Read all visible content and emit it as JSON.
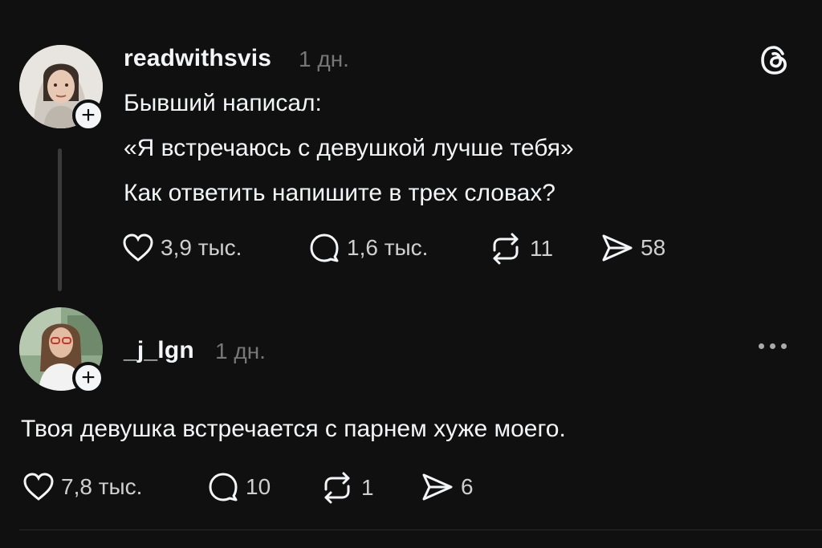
{
  "post": {
    "username": "readwithsvis",
    "time": "1 дн.",
    "lines": [
      "Бывший написал:",
      "«Я встречаюсь с девушкой лучше тебя»",
      "Как ответить напишите в трех словах?"
    ],
    "likes": "3,9 тыс.",
    "comments": "1,6 тыс.",
    "reposts": "11",
    "shares": "58"
  },
  "reply": {
    "username": "_j_lgn",
    "time": "1 дн.",
    "text": "Твоя девушка встречается с парнем хуже моего.",
    "likes": "7,8 тыс.",
    "comments": "10",
    "reposts": "1",
    "shares": "6"
  },
  "icons": {
    "follow": "plus-icon",
    "like": "heart-icon",
    "comment": "comment-icon",
    "repost": "repost-icon",
    "share": "send-icon",
    "brand": "threads-logo-icon",
    "more": "more-dots-icon"
  },
  "colors": {
    "background": "#101010",
    "text": "#f3f5f7",
    "muted": "#777777"
  }
}
